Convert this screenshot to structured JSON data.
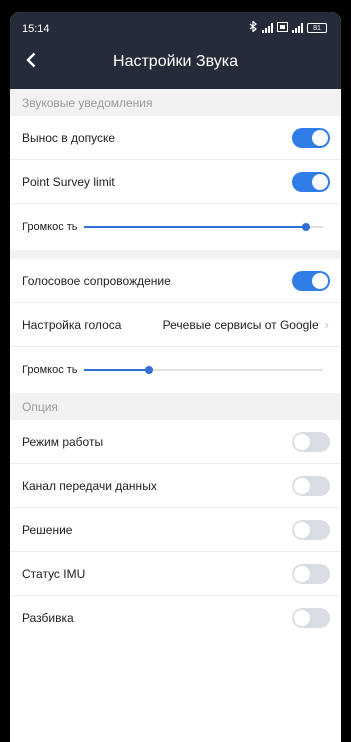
{
  "status": {
    "time": "15:14",
    "battery": "81"
  },
  "header": {
    "title": "Настройки Звука"
  },
  "sections": {
    "sound_alerts": "Звуковые уведомления",
    "options": "Опция"
  },
  "rows": {
    "stakeout_tolerance": {
      "label": "Вынос в допуске",
      "on": true
    },
    "point_survey_limit": {
      "label": "Point Survey limit",
      "on": true
    },
    "volume1": {
      "label": "Громкос ть",
      "level": 0.93
    },
    "voice_guidance": {
      "label": "Голосовое сопровождение",
      "on": true
    },
    "voice_setting": {
      "label": "Настройка голоса",
      "value": "Речевые сервисы от Google"
    },
    "volume2": {
      "label": "Громкос ть",
      "level": 0.27
    },
    "work_mode": {
      "label": "Режим работы",
      "on": false
    },
    "data_channel": {
      "label": "Канал передачи данных",
      "on": false
    },
    "solution": {
      "label": "Решение",
      "on": false
    },
    "imu_status": {
      "label": "Статус IMU",
      "on": false
    },
    "stakeout": {
      "label": "Разбивка",
      "on": false
    }
  },
  "colors": {
    "accent": "#2f7ee8",
    "header_bg": "#252b38",
    "section_bg": "#f2f2f2"
  },
  "icons": {
    "back": "chevron-left-icon",
    "bluetooth": "bluetooth-icon",
    "signal": "signal-icon",
    "battery": "battery-icon"
  }
}
